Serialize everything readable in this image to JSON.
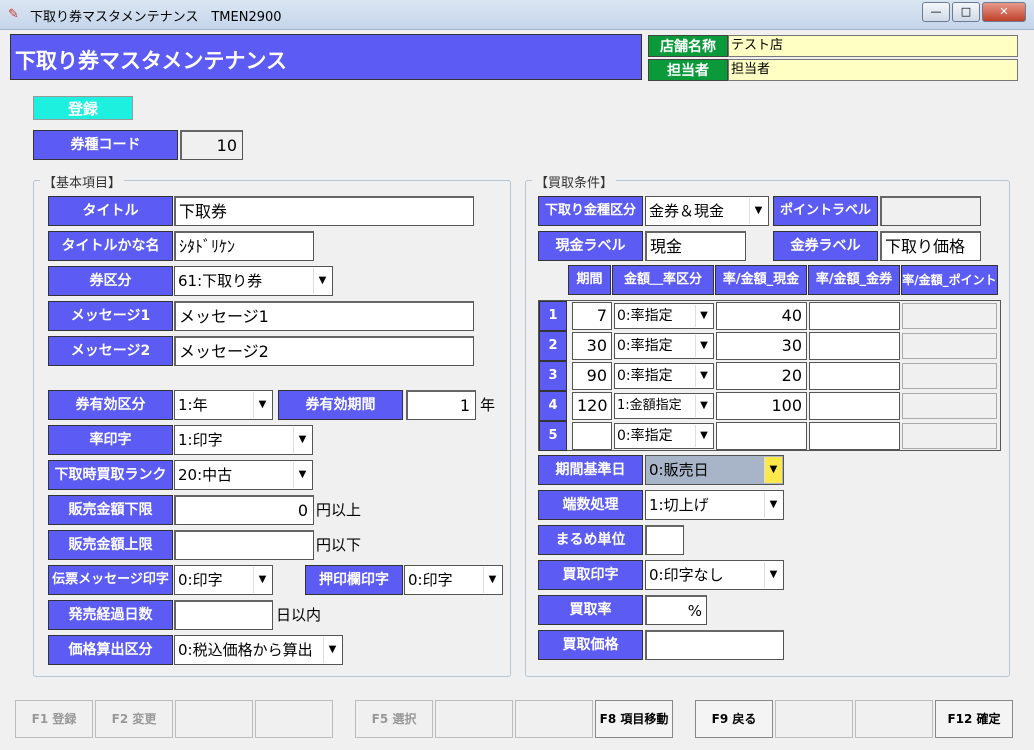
{
  "window": {
    "title": "下取り券マスタメンテナンス　TMEN2900",
    "minimize": "—",
    "maximize": "□",
    "close": "✕"
  },
  "header": {
    "title": "下取り券マスタメンテナンス",
    "store_label": "店舗名称",
    "store_value": "テスト店",
    "staff_label": "担当者",
    "staff_value": "担当者"
  },
  "register_button": "登録",
  "voucher_code": {
    "label": "券種コード",
    "value": "10"
  },
  "basic": {
    "group_title": "【基本項目】",
    "title_label": "タイトル",
    "title_value": "下取券",
    "kana_label": "タイトルかな名",
    "kana_value": "ｼﾀﾄﾞﾘｹﾝ",
    "kubun_label": "券区分",
    "kubun_value": "61:下取り券",
    "msg1_label": "メッセージ1",
    "msg1_value": "メッセージ1",
    "msg2_label": "メッセージ2",
    "msg2_value": "メッセージ2",
    "valid_kubun_label": "券有効区分",
    "valid_kubun_value": "1:年",
    "valid_period_label": "券有効期間",
    "valid_period_value": "1",
    "valid_period_unit": "年",
    "rate_print_label": "率印字",
    "rate_print_value": "1:印字",
    "rank_label": "下取時買取ランク",
    "rank_value": "20:中古",
    "min_label": "販売金額下限",
    "min_value": "0",
    "min_suffix": "円以上",
    "max_label": "販売金額上限",
    "max_value": "",
    "max_suffix": "円以下",
    "slip_label": "伝票メッセージ印字",
    "slip_value": "0:印字",
    "stamp_label": "押印欄印字",
    "stamp_value": "0:印字",
    "days_label": "発売経過日数",
    "days_value": "",
    "days_suffix": "日以内",
    "price_label": "価格算出区分",
    "price_value": "0:税込価格から算出"
  },
  "purchase": {
    "group_title": "【買取条件】",
    "money_kind_label": "下取り金種区分",
    "money_kind_value": "金券＆現金",
    "point_label": "ポイントラベル",
    "point_value": "",
    "cash_label": "現金ラベル",
    "cash_value": "現金",
    "ticket_label": "金券ラベル",
    "ticket_value": "下取り価格",
    "table_headers": [
      "期間",
      "金額＿率区分",
      "率/金額_現金",
      "率/金額_金券",
      "率/金額_ポイント"
    ],
    "rows": [
      {
        "no": "1",
        "period": "7",
        "kubun": "0:率指定",
        "cash": "40",
        "ticket": "",
        "point": ""
      },
      {
        "no": "2",
        "period": "30",
        "kubun": "0:率指定",
        "cash": "30",
        "ticket": "",
        "point": ""
      },
      {
        "no": "3",
        "period": "90",
        "kubun": "0:率指定",
        "cash": "20",
        "ticket": "",
        "point": ""
      },
      {
        "no": "4",
        "period": "120",
        "kubun": "1:金額指定",
        "cash": "100",
        "ticket": "",
        "point": ""
      },
      {
        "no": "5",
        "period": "",
        "kubun": "0:率指定",
        "cash": "",
        "ticket": "",
        "point": ""
      }
    ],
    "base_date_label": "期間基準日",
    "base_date_value": "0:販売日",
    "rounding_label": "端数処理",
    "rounding_value": "1:切上げ",
    "round_unit_label": "まるめ単位",
    "round_unit_value": "",
    "print_label": "買取印字",
    "print_value": "0:印字なし",
    "rate_label": "買取率",
    "rate_value": "",
    "rate_unit": "%",
    "price_label": "買取価格",
    "price_value": ""
  },
  "footer": {
    "keys": [
      "F1 登録",
      "F2 変更",
      "",
      "",
      "F5 選択",
      "",
      "",
      "F8 項目移動",
      "F9 戻る",
      "",
      "",
      "F12 確定"
    ]
  }
}
